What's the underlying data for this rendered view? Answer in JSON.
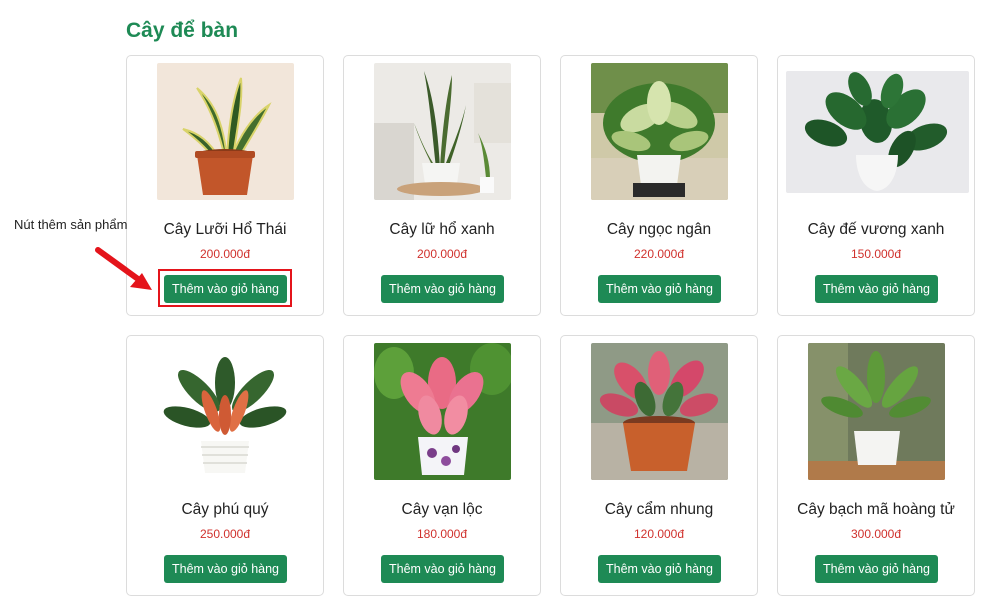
{
  "section": {
    "title": "Cây để bàn"
  },
  "annotation": {
    "label": "Nút thêm sản phẩm",
    "highlight_color": "#e4141b"
  },
  "colors": {
    "brand_green": "#1e8a55",
    "price_red": "#d0312d"
  },
  "products": [
    {
      "name": "Cây Lưỡi Hổ Thái",
      "price": "200.000đ",
      "button": "Thêm vào giỏ hàng"
    },
    {
      "name": "Cây lữ hổ xanh",
      "price": "200.000đ",
      "button": "Thêm vào giỏ hàng"
    },
    {
      "name": "Cây ngọc ngân",
      "price": "220.000đ",
      "button": "Thêm vào giỏ hàng"
    },
    {
      "name": "Cây đế vương xanh",
      "price": "150.000đ",
      "button": "Thêm vào giỏ hàng"
    },
    {
      "name": "Cây phú quý",
      "price": "250.000đ",
      "button": "Thêm vào giỏ hàng"
    },
    {
      "name": "Cây vạn lộc",
      "price": "180.000đ",
      "button": "Thêm vào giỏ hàng"
    },
    {
      "name": "Cây cẩm nhung",
      "price": "120.000đ",
      "button": "Thêm vào giỏ hàng"
    },
    {
      "name": "Cây bạch mã hoàng tử",
      "price": "300.000đ",
      "button": "Thêm vào giỏ hàng"
    }
  ]
}
